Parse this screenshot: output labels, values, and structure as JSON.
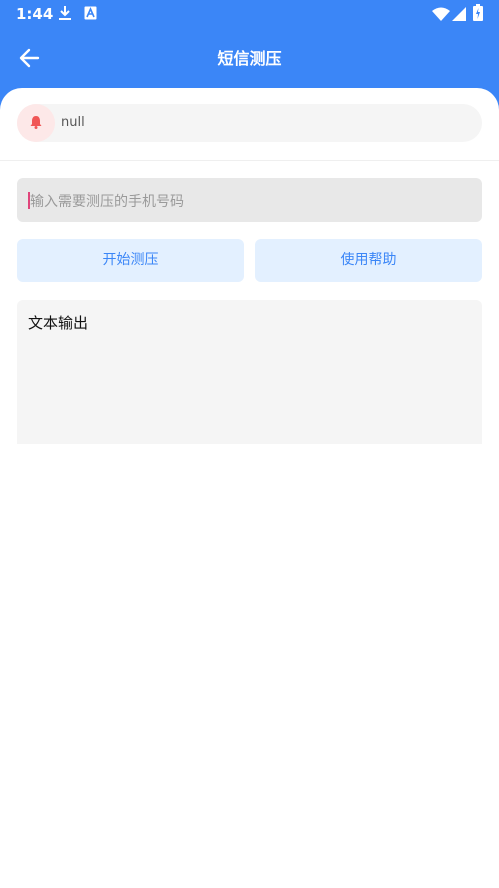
{
  "status_bar": {
    "time": "1:44"
  },
  "app_bar": {
    "title": "短信测压"
  },
  "notice": {
    "text": "null"
  },
  "phone_input": {
    "placeholder": "输入需要测压的手机号码"
  },
  "buttons": {
    "start": "开始测压",
    "help": "使用帮助"
  },
  "output": {
    "text": "文本输出"
  },
  "colors": {
    "primary": "#3b86f7",
    "button_bg": "#e3f0ff",
    "bell": "#f05656"
  }
}
